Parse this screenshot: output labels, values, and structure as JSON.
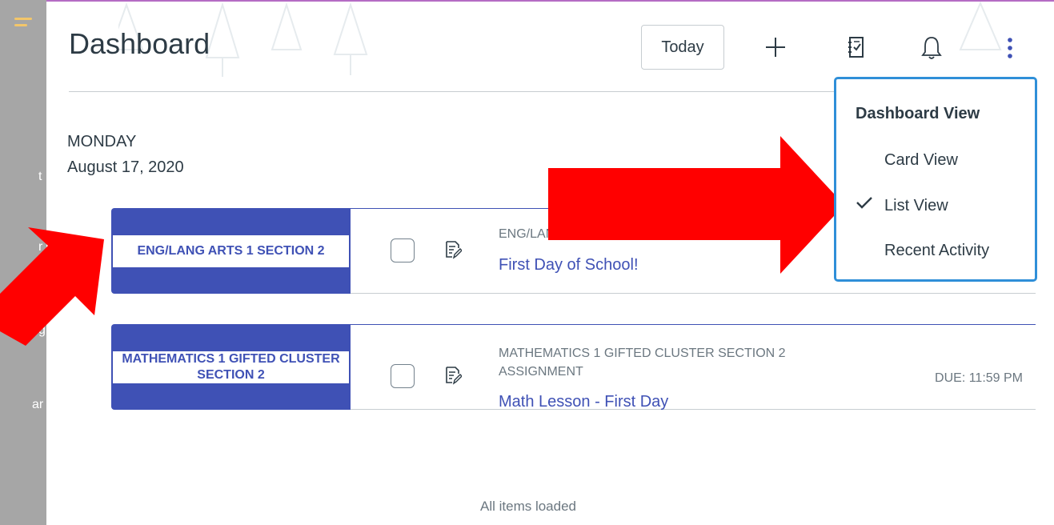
{
  "header": {
    "title": "Dashboard",
    "today_label": "Today",
    "add_icon": "plus-icon",
    "todo_icon": "checklist-icon",
    "notifications_icon": "bell-icon",
    "more_icon": "kebab-menu-icon"
  },
  "sidenav": {
    "menu_icon": "hamburger-icon",
    "fragments": [
      "t",
      "r",
      "g",
      "ar"
    ]
  },
  "day": {
    "weekday": "MONDAY",
    "date": "August 17, 2020"
  },
  "items": [
    {
      "course": "ENG/LANG ARTS 1 SECTION 2",
      "context": "ENG/LANG ARTS 1 SECTION 2 ASSIGNMENT",
      "title": "First Day of School!",
      "due": ""
    },
    {
      "course": "MATHEMATICS 1 GIFTED CLUSTER SECTION 2",
      "context_line1": "MATHEMATICS 1 GIFTED CLUSTER SECTION 2",
      "context_line2": "ASSIGNMENT",
      "title": "Math Lesson - First Day",
      "due": "DUE: 11:59 PM"
    }
  ],
  "status": {
    "all_loaded": "All items loaded"
  },
  "view_menu": {
    "heading": "Dashboard View",
    "options": [
      {
        "label": "Card View",
        "selected": false
      },
      {
        "label": "List View",
        "selected": true
      },
      {
        "label": "Recent Activity",
        "selected": false
      }
    ]
  },
  "colors": {
    "course_accent": "#3f51b5",
    "menu_border": "#2f8fd8",
    "annotation_arrow": "#ff0000"
  }
}
